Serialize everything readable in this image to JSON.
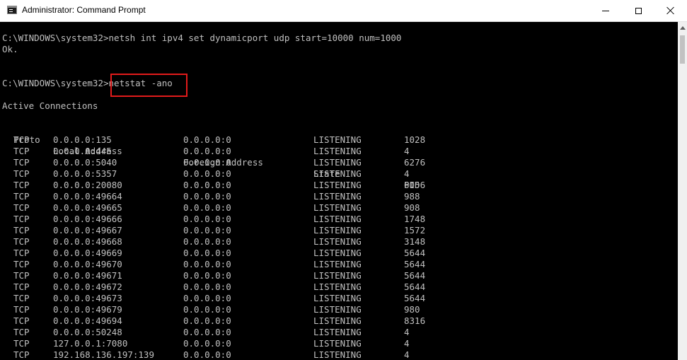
{
  "window": {
    "title": "Administrator: Command Prompt",
    "icon": "cmd-icon",
    "controls": [
      "minimize-icon",
      "maximize-icon",
      "close-icon"
    ]
  },
  "console": {
    "line1": "C:\\WINDOWS\\system32>netsh int ipv4 set dynamicport udp start=10000 num=1000",
    "line2": "Ok.",
    "prompt": "C:\\WINDOWS\\system32>",
    "command": "netstat -ano",
    "heading": "Active Connections",
    "highlight_color": "#e21b1b"
  },
  "table": {
    "headers": {
      "proto": "Proto",
      "local": "Local Address",
      "foreign": "Foreign Address",
      "state": "State",
      "pid": "PID"
    },
    "rows": [
      {
        "proto": "TCP",
        "local": "0.0.0.0:135",
        "foreign": "0.0.0.0:0",
        "state": "LISTENING",
        "pid": "1028"
      },
      {
        "proto": "TCP",
        "local": "0.0.0.0:445",
        "foreign": "0.0.0.0:0",
        "state": "LISTENING",
        "pid": "4"
      },
      {
        "proto": "TCP",
        "local": "0.0.0.0:5040",
        "foreign": "0.0.0.0:0",
        "state": "LISTENING",
        "pid": "6276"
      },
      {
        "proto": "TCP",
        "local": "0.0.0.0:5357",
        "foreign": "0.0.0.0:0",
        "state": "LISTENING",
        "pid": "4"
      },
      {
        "proto": "TCP",
        "local": "0.0.0.0:20080",
        "foreign": "0.0.0.0:0",
        "state": "LISTENING",
        "pid": "6056"
      },
      {
        "proto": "TCP",
        "local": "0.0.0.0:49664",
        "foreign": "0.0.0.0:0",
        "state": "LISTENING",
        "pid": "988"
      },
      {
        "proto": "TCP",
        "local": "0.0.0.0:49665",
        "foreign": "0.0.0.0:0",
        "state": "LISTENING",
        "pid": "908"
      },
      {
        "proto": "TCP",
        "local": "0.0.0.0:49666",
        "foreign": "0.0.0.0:0",
        "state": "LISTENING",
        "pid": "1748"
      },
      {
        "proto": "TCP",
        "local": "0.0.0.0:49667",
        "foreign": "0.0.0.0:0",
        "state": "LISTENING",
        "pid": "1572"
      },
      {
        "proto": "TCP",
        "local": "0.0.0.0:49668",
        "foreign": "0.0.0.0:0",
        "state": "LISTENING",
        "pid": "3148"
      },
      {
        "proto": "TCP",
        "local": "0.0.0.0:49669",
        "foreign": "0.0.0.0:0",
        "state": "LISTENING",
        "pid": "5644"
      },
      {
        "proto": "TCP",
        "local": "0.0.0.0:49670",
        "foreign": "0.0.0.0:0",
        "state": "LISTENING",
        "pid": "5644"
      },
      {
        "proto": "TCP",
        "local": "0.0.0.0:49671",
        "foreign": "0.0.0.0:0",
        "state": "LISTENING",
        "pid": "5644"
      },
      {
        "proto": "TCP",
        "local": "0.0.0.0:49672",
        "foreign": "0.0.0.0:0",
        "state": "LISTENING",
        "pid": "5644"
      },
      {
        "proto": "TCP",
        "local": "0.0.0.0:49673",
        "foreign": "0.0.0.0:0",
        "state": "LISTENING",
        "pid": "5644"
      },
      {
        "proto": "TCP",
        "local": "0.0.0.0:49679",
        "foreign": "0.0.0.0:0",
        "state": "LISTENING",
        "pid": "980"
      },
      {
        "proto": "TCP",
        "local": "0.0.0.0:49694",
        "foreign": "0.0.0.0:0",
        "state": "LISTENING",
        "pid": "8316"
      },
      {
        "proto": "TCP",
        "local": "0.0.0.0:50248",
        "foreign": "0.0.0.0:0",
        "state": "LISTENING",
        "pid": "4"
      },
      {
        "proto": "TCP",
        "local": "127.0.0.1:7080",
        "foreign": "0.0.0.0:0",
        "state": "LISTENING",
        "pid": "4"
      },
      {
        "proto": "TCP",
        "local": "192.168.136.197:139",
        "foreign": "0.0.0.0:0",
        "state": "LISTENING",
        "pid": "4"
      }
    ]
  }
}
